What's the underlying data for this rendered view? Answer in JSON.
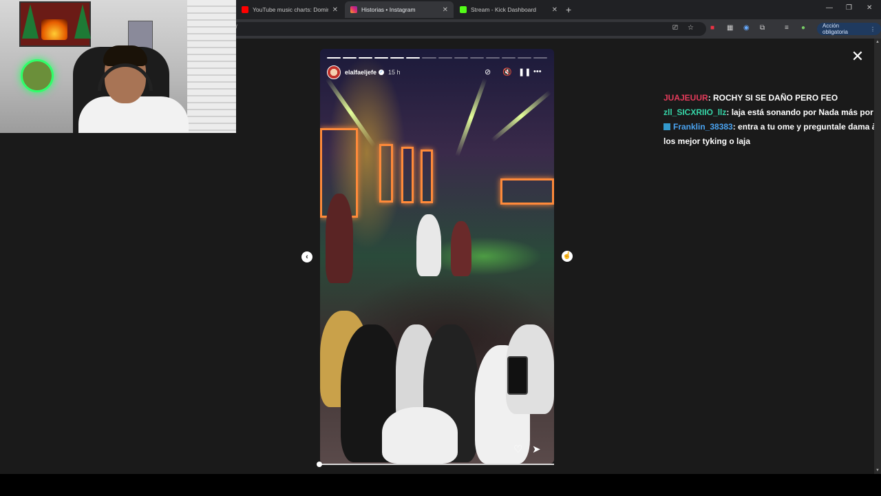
{
  "browser": {
    "tabs": [
      {
        "label": "YouTube music charts: Dominic",
        "icon": "youtube-icon",
        "color": "#ff0000",
        "active": false
      },
      {
        "label": "Historias • Instagram",
        "icon": "instagram-icon",
        "color": "#e1306c",
        "active": true
      },
      {
        "label": "Stream - Kick Dashboard",
        "icon": "kick-icon",
        "color": "#53fc18",
        "active": false
      }
    ],
    "url": "/",
    "action_button": "Acción obligatoria"
  },
  "story": {
    "username": "elalfaeljefe",
    "time_ago": "15 h",
    "progress_total": 14,
    "progress_done": 6
  },
  "chat": {
    "messages": [
      {
        "user": "JUAJEUUR",
        "user_color": "#e53b5b",
        "text": ": ROCHY SI SE DAÑO PERO FEO",
        "badge": false
      },
      {
        "user": "zll_SICXRIIO_llz",
        "user_color": "#36d6a8",
        "text": ": laja está sonando por Nada más por Blac",
        "badge": false
      },
      {
        "user": "Franklin_38383",
        "user_color": "#4aa3f0",
        "text": ": entra a tu ome y preguntale dama à los mejor tyking o laja",
        "badge": true
      }
    ]
  }
}
